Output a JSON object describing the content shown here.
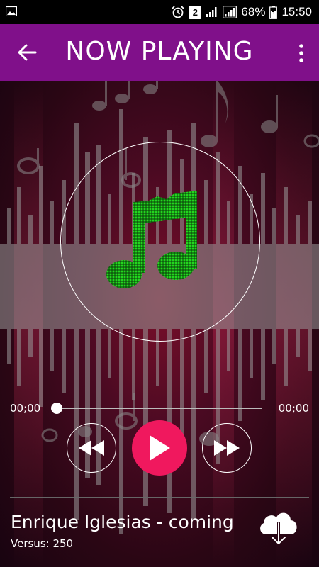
{
  "status_bar": {
    "sim_slot": "2",
    "battery": "68%",
    "time": "15:50",
    "icons": [
      "image-icon",
      "alarm-icon",
      "signal-icon",
      "battery-icon"
    ]
  },
  "app_bar": {
    "title": "NOW PLAYING",
    "back_icon": "arrow-left-icon",
    "menu_icon": "more-vert-icon",
    "color": "#80108a"
  },
  "player": {
    "elapsed": "00;00",
    "duration": "00;00",
    "progress": 0,
    "art_icon": "music-note-icon",
    "art_color": "#23d61f",
    "controls": {
      "rewind_icon": "rewind-icon",
      "play_icon": "play-icon",
      "forward_icon": "fast-forward-icon",
      "play_color": "#f0185e"
    }
  },
  "track": {
    "title": "Enrique Iglesias - coming",
    "subtitle": "Versus: 250",
    "download_icon": "cloud-download-icon"
  }
}
